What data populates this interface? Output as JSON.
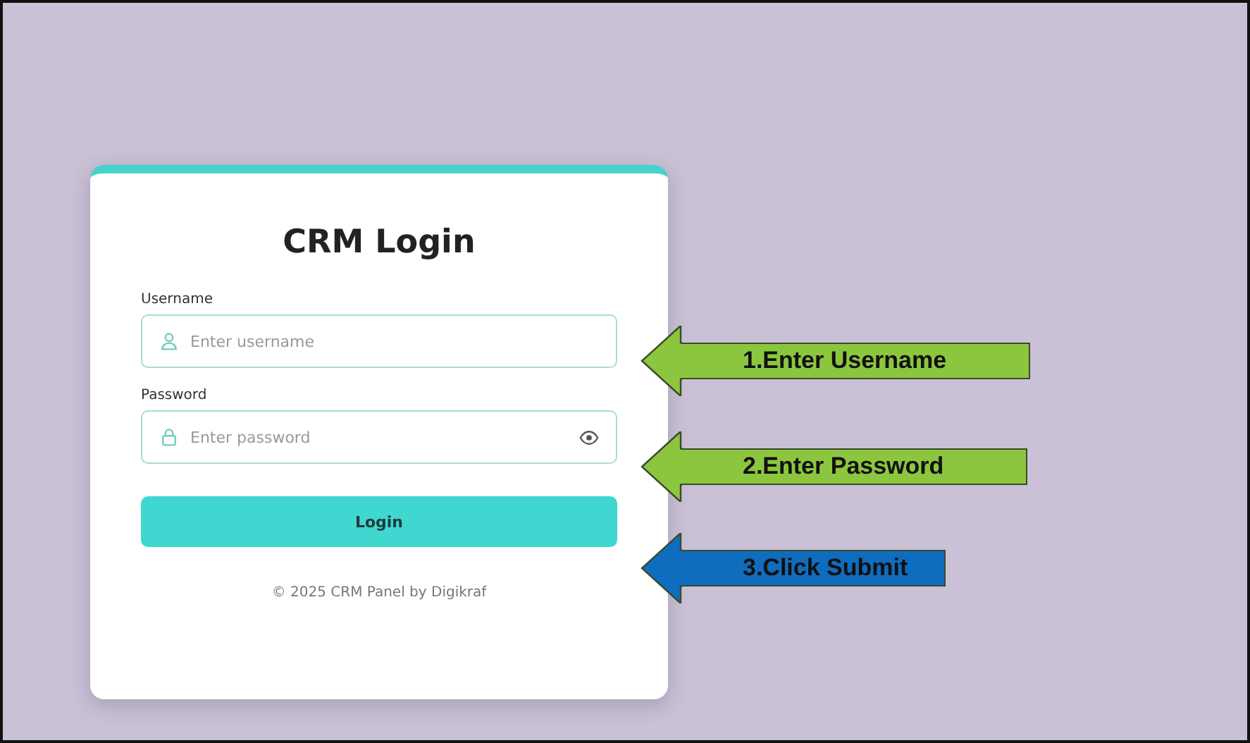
{
  "login_card": {
    "title": "CRM Login",
    "fields": [
      {
        "kind": "username",
        "label": "Username",
        "placeholder": "Enter username"
      },
      {
        "kind": "password",
        "label": "Password",
        "placeholder": "Enter password"
      }
    ],
    "submit_button": "Login",
    "footer": "© 2025 CRM Panel by Digikraf"
  },
  "callouts": [
    {
      "label": "1.Enter Username",
      "color": "#8cc63f"
    },
    {
      "label": "2.Enter Password",
      "color": "#8cc63f"
    },
    {
      "label": "3.Click Submit",
      "color": "#0f6dbf"
    }
  ]
}
